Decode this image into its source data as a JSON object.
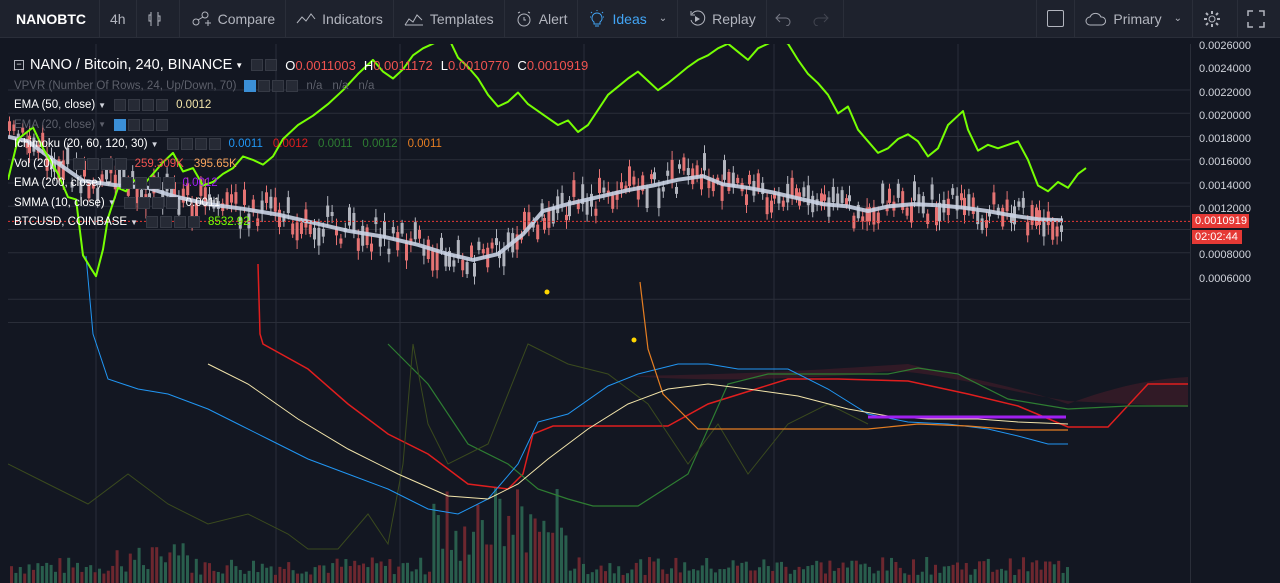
{
  "toolbar": {
    "symbol": "NANOBTC",
    "interval": "4h",
    "compare": "Compare",
    "indicators": "Indicators",
    "templates": "Templates",
    "alert": "Alert",
    "ideas": "Ideas",
    "replay": "Replay",
    "layout": "Primary"
  },
  "legend": {
    "main": {
      "name": "NANO / Bitcoin, 240, BINANCE",
      "o_label": "O",
      "o": "0.0011003",
      "h_label": "H",
      "h": "0.0011172",
      "l_label": "L",
      "l": "0.0010770",
      "c_label": "C",
      "c": "0.0010919"
    },
    "vpvr": {
      "name": "VPVR (Number Of Rows, 24, Up/Down, 70)",
      "v1": "n/a",
      "v2": "n/a",
      "v3": "n/a"
    },
    "ema50": {
      "name": "EMA (50, close)",
      "v": "0.0012"
    },
    "ema20": {
      "name": "EMA (20, close)"
    },
    "ichimoku": {
      "name": "Ichimoku (20, 60, 120, 30)",
      "v1": "0.0011",
      "v2": "0.0012",
      "v3": "0.0011",
      "v4": "0.0012",
      "v5": "0.0011"
    },
    "vol": {
      "name": "Vol (20)",
      "v1": "259.309K",
      "v2": "395.65K"
    },
    "ema200": {
      "name": "EMA (200, close)",
      "v": "0.0012"
    },
    "smma": {
      "name": "SMMA (10, close)",
      "v": "0.0011"
    },
    "btcusd": {
      "name": "BTCUSD, COINBASE",
      "v": "8532.92"
    }
  },
  "axis": {
    "ticks": [
      "0.0026000",
      "0.0024000",
      "0.0022000",
      "0.0020000",
      "0.0018000",
      "0.0016000",
      "0.0014000",
      "0.0012000",
      "0.0008000",
      "0.0006000"
    ],
    "last_price": "0.0010919",
    "countdown": "02:02:44"
  },
  "colors": {
    "background": "#131722",
    "btcusd": "#76ff03",
    "smma": "#c9d2e3",
    "ema50": "#f3e5ab",
    "ema200": "#a020f0",
    "ichimoku_conversion": "#2196f3",
    "ichimoku_base": "#e01e1e",
    "ichimoku_span_a": "#2e7d32",
    "ichimoku_span_b": "#e53935",
    "candle_up": "#b2b5be",
    "candle_down": "#e57373",
    "volume": "#2e7d5e",
    "price_line": "#e53935"
  }
}
